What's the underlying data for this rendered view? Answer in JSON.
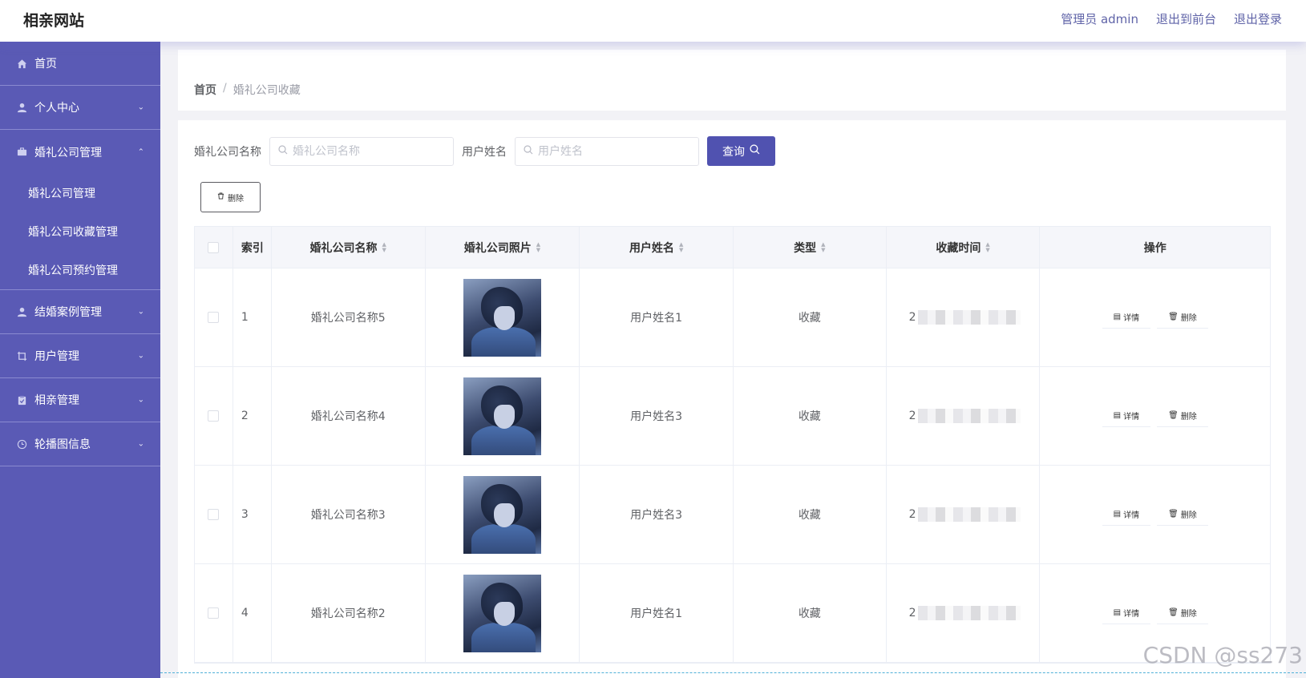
{
  "header": {
    "brand": "相亲网站",
    "links": [
      "管理员 admin",
      "退出到前台",
      "退出登录"
    ]
  },
  "sidebar": {
    "items": [
      {
        "label": "首页",
        "icon": "home-icon",
        "chevron": ""
      },
      {
        "label": "个人中心",
        "icon": "user-icon",
        "chevron": "⌄"
      },
      {
        "label": "婚礼公司管理",
        "icon": "briefcase-icon",
        "chevron": "⌃",
        "sub": [
          "婚礼公司管理",
          "婚礼公司收藏管理",
          "婚礼公司预约管理"
        ]
      },
      {
        "label": "结婚案例管理",
        "icon": "user-icon",
        "chevron": "⌄"
      },
      {
        "label": "用户管理",
        "icon": "crop-icon",
        "chevron": "⌄"
      },
      {
        "label": "相亲管理",
        "icon": "clipboard-icon",
        "chevron": "⌄"
      },
      {
        "label": "轮播图信息",
        "icon": "clock-icon",
        "chevron": "⌄"
      }
    ]
  },
  "breadcrumb": {
    "home": "首页",
    "separator": "/",
    "current": "婚礼公司收藏"
  },
  "filters": {
    "company_label": "婚礼公司名称",
    "company_placeholder": "婚礼公司名称",
    "user_label": "用户姓名",
    "user_placeholder": "用户姓名",
    "query_label": "查询"
  },
  "delete_label": "删除",
  "table": {
    "headers": {
      "index": "索引",
      "name": "婚礼公司名称",
      "photo": "婚礼公司照片",
      "user": "用户姓名",
      "type": "类型",
      "time": "收藏时间",
      "op": "操作"
    },
    "rows": [
      {
        "index": "1",
        "name": "婚礼公司名称5",
        "user": "用户姓名1",
        "type": "收藏",
        "time_prefix": "2"
      },
      {
        "index": "2",
        "name": "婚礼公司名称4",
        "user": "用户姓名3",
        "type": "收藏",
        "time_prefix": "2"
      },
      {
        "index": "3",
        "name": "婚礼公司名称3",
        "user": "用户姓名3",
        "type": "收藏",
        "time_prefix": "2"
      },
      {
        "index": "4",
        "name": "婚礼公司名称2",
        "user": "用户姓名1",
        "type": "收藏",
        "time_prefix": "2"
      }
    ],
    "detail_label": "详情",
    "delete_label": "删除"
  },
  "watermark": "CSDN @ss273",
  "colors": {
    "sidebar": "#5a5ab5",
    "accent": "#5052b0",
    "link": "#6064a8"
  }
}
